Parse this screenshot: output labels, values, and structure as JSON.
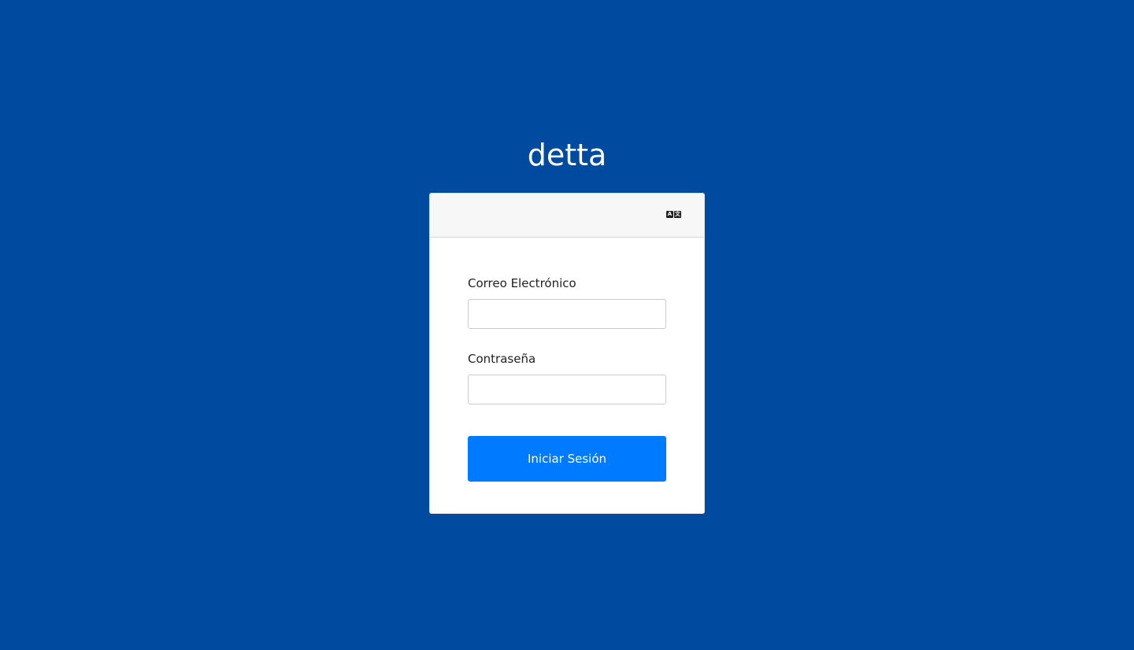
{
  "brand": {
    "title": "detta"
  },
  "header": {
    "language_icon": "language-translate-icon",
    "language_icon_glyphs": [
      "A",
      "文"
    ]
  },
  "form": {
    "email_label": "Correo Electrónico",
    "email_value": "",
    "password_label": "Contraseña",
    "password_value": "",
    "submit_label": "Iniciar Sesión"
  },
  "colors": {
    "background": "#004aa0",
    "primary_button": "#007bff",
    "card_header": "#f7f7f7"
  }
}
